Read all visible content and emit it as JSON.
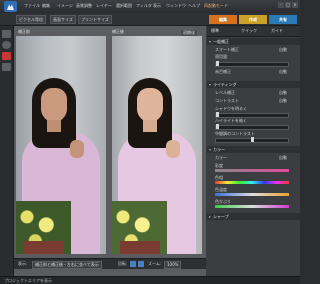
{
  "menubar": {
    "items": [
      "ファイル",
      "編集",
      "イメージ",
      "画質調整",
      "レイヤー",
      "選択範囲",
      "フィルタ",
      "表示",
      "ウィンドウ",
      "ヘルプ",
      "再起動モード"
    ]
  },
  "window_buttons": [
    "-",
    "□",
    "×"
  ],
  "view_toolbar": {
    "buttons": [
      "ピクセル等倍",
      "画面サイズ",
      "プリントサイズ"
    ]
  },
  "mode_tabs": [
    {
      "label": "編集",
      "color": "#d6721f"
    },
    {
      "label": "作成",
      "color": "#c9a12a"
    },
    {
      "label": "共有",
      "color": "#2b7ab8"
    }
  ],
  "photo_panes": {
    "before_label": "補正前",
    "after_label": "補正後",
    "reset_label": "初期化"
  },
  "bottom_bar": {
    "view_label": "表示:",
    "view_select": "補正前と補正後・左右に並べて表示",
    "rotate_label": "回転:",
    "zoom_label": "ズーム:",
    "zoom_value": "100%"
  },
  "right_panel": {
    "tabs": [
      "標準",
      "クイック",
      "ガイド"
    ],
    "section_overall": {
      "title": "一般補正",
      "smart_fix_label": "スマート補正",
      "smart_fix_sub": "適用量:",
      "auto_label": "自動",
      "red_eye_label": "赤目補正",
      "red_eye_auto": "自動"
    },
    "section_lighting": {
      "title": "ライティング",
      "levels_label": "レベル補正",
      "levels_auto": "自動",
      "contrast_label": "コントラスト",
      "contrast_auto": "自動",
      "shadows_label": "シャドウを明るく",
      "highlights_label": "ハイライトを暗く",
      "midtone_label": "中間調のコントラスト"
    },
    "section_color": {
      "title": "カラー",
      "color_label": "カラー",
      "color_auto": "自動",
      "saturation_label": "彩度",
      "hue_label": "色相",
      "temperature_label": "色温度",
      "tint_label": "色かぶり"
    },
    "section_sharpen": {
      "title": "シャープ"
    }
  },
  "statusbar": {
    "text": "プロジェクトエリアを表示"
  },
  "colors": {
    "accent_orange": "#d6721f",
    "accent_blue": "#2b7ab8"
  }
}
